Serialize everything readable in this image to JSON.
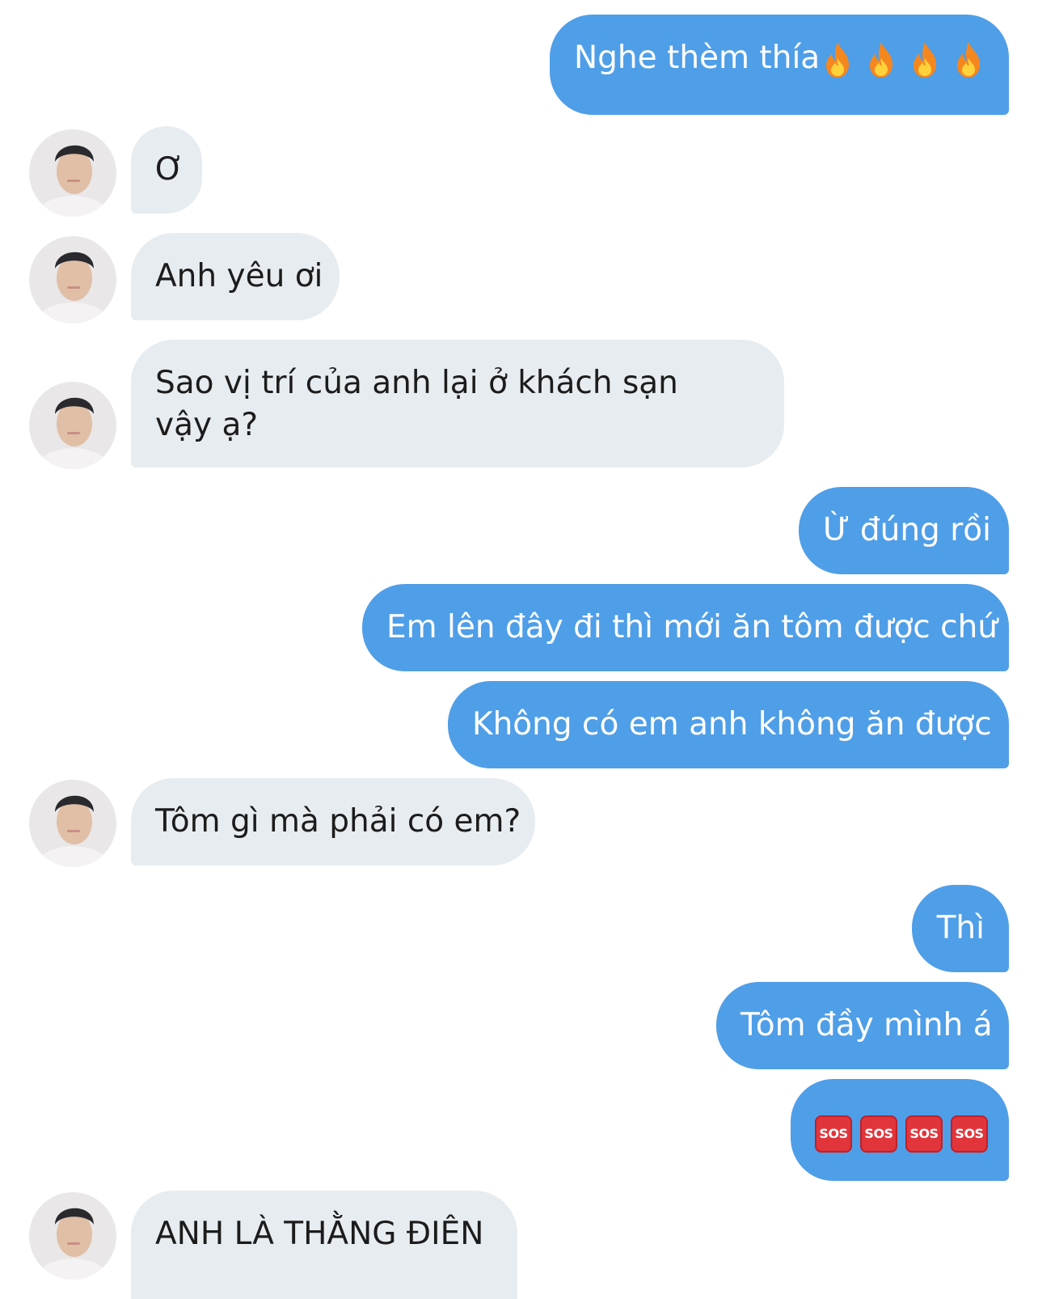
{
  "conversation": {
    "messages": [
      {
        "side": "outgoing",
        "text": "Nghe thèm thía",
        "emoji": [
          "fire-icon",
          "fire-icon",
          "fire-icon",
          "fire-icon"
        ]
      },
      {
        "side": "incoming",
        "text": "Ơ"
      },
      {
        "side": "incoming",
        "text": "Anh yêu ơi"
      },
      {
        "side": "incoming",
        "text": "Sao vị trí của anh lại ở khách sạn vậy ạ?"
      },
      {
        "side": "outgoing",
        "text": "Ừ đúng rồi"
      },
      {
        "side": "outgoing",
        "text": "Em lên đây đi thì mới ăn tôm được chứ"
      },
      {
        "side": "outgoing",
        "text": "Không có em anh không ăn được"
      },
      {
        "side": "incoming",
        "text": "Tôm gì mà phải có em?"
      },
      {
        "side": "outgoing",
        "text": "Thì"
      },
      {
        "side": "outgoing",
        "text": "Tôm đầy mình á"
      },
      {
        "side": "outgoing",
        "text": "",
        "emoji": [
          "sos-icon",
          "sos-icon",
          "sos-icon",
          "sos-icon"
        ],
        "emoji_label": "SOS"
      },
      {
        "side": "incoming",
        "text": "ANH LÀ THẰNG ĐIÊN"
      }
    ]
  },
  "colors": {
    "outgoing_bubble": "#4f9ee8",
    "incoming_bubble": "#e7ecf0",
    "outgoing_text": "#ffffff",
    "incoming_text": "#1c1c1c",
    "background": "#ffffff"
  }
}
